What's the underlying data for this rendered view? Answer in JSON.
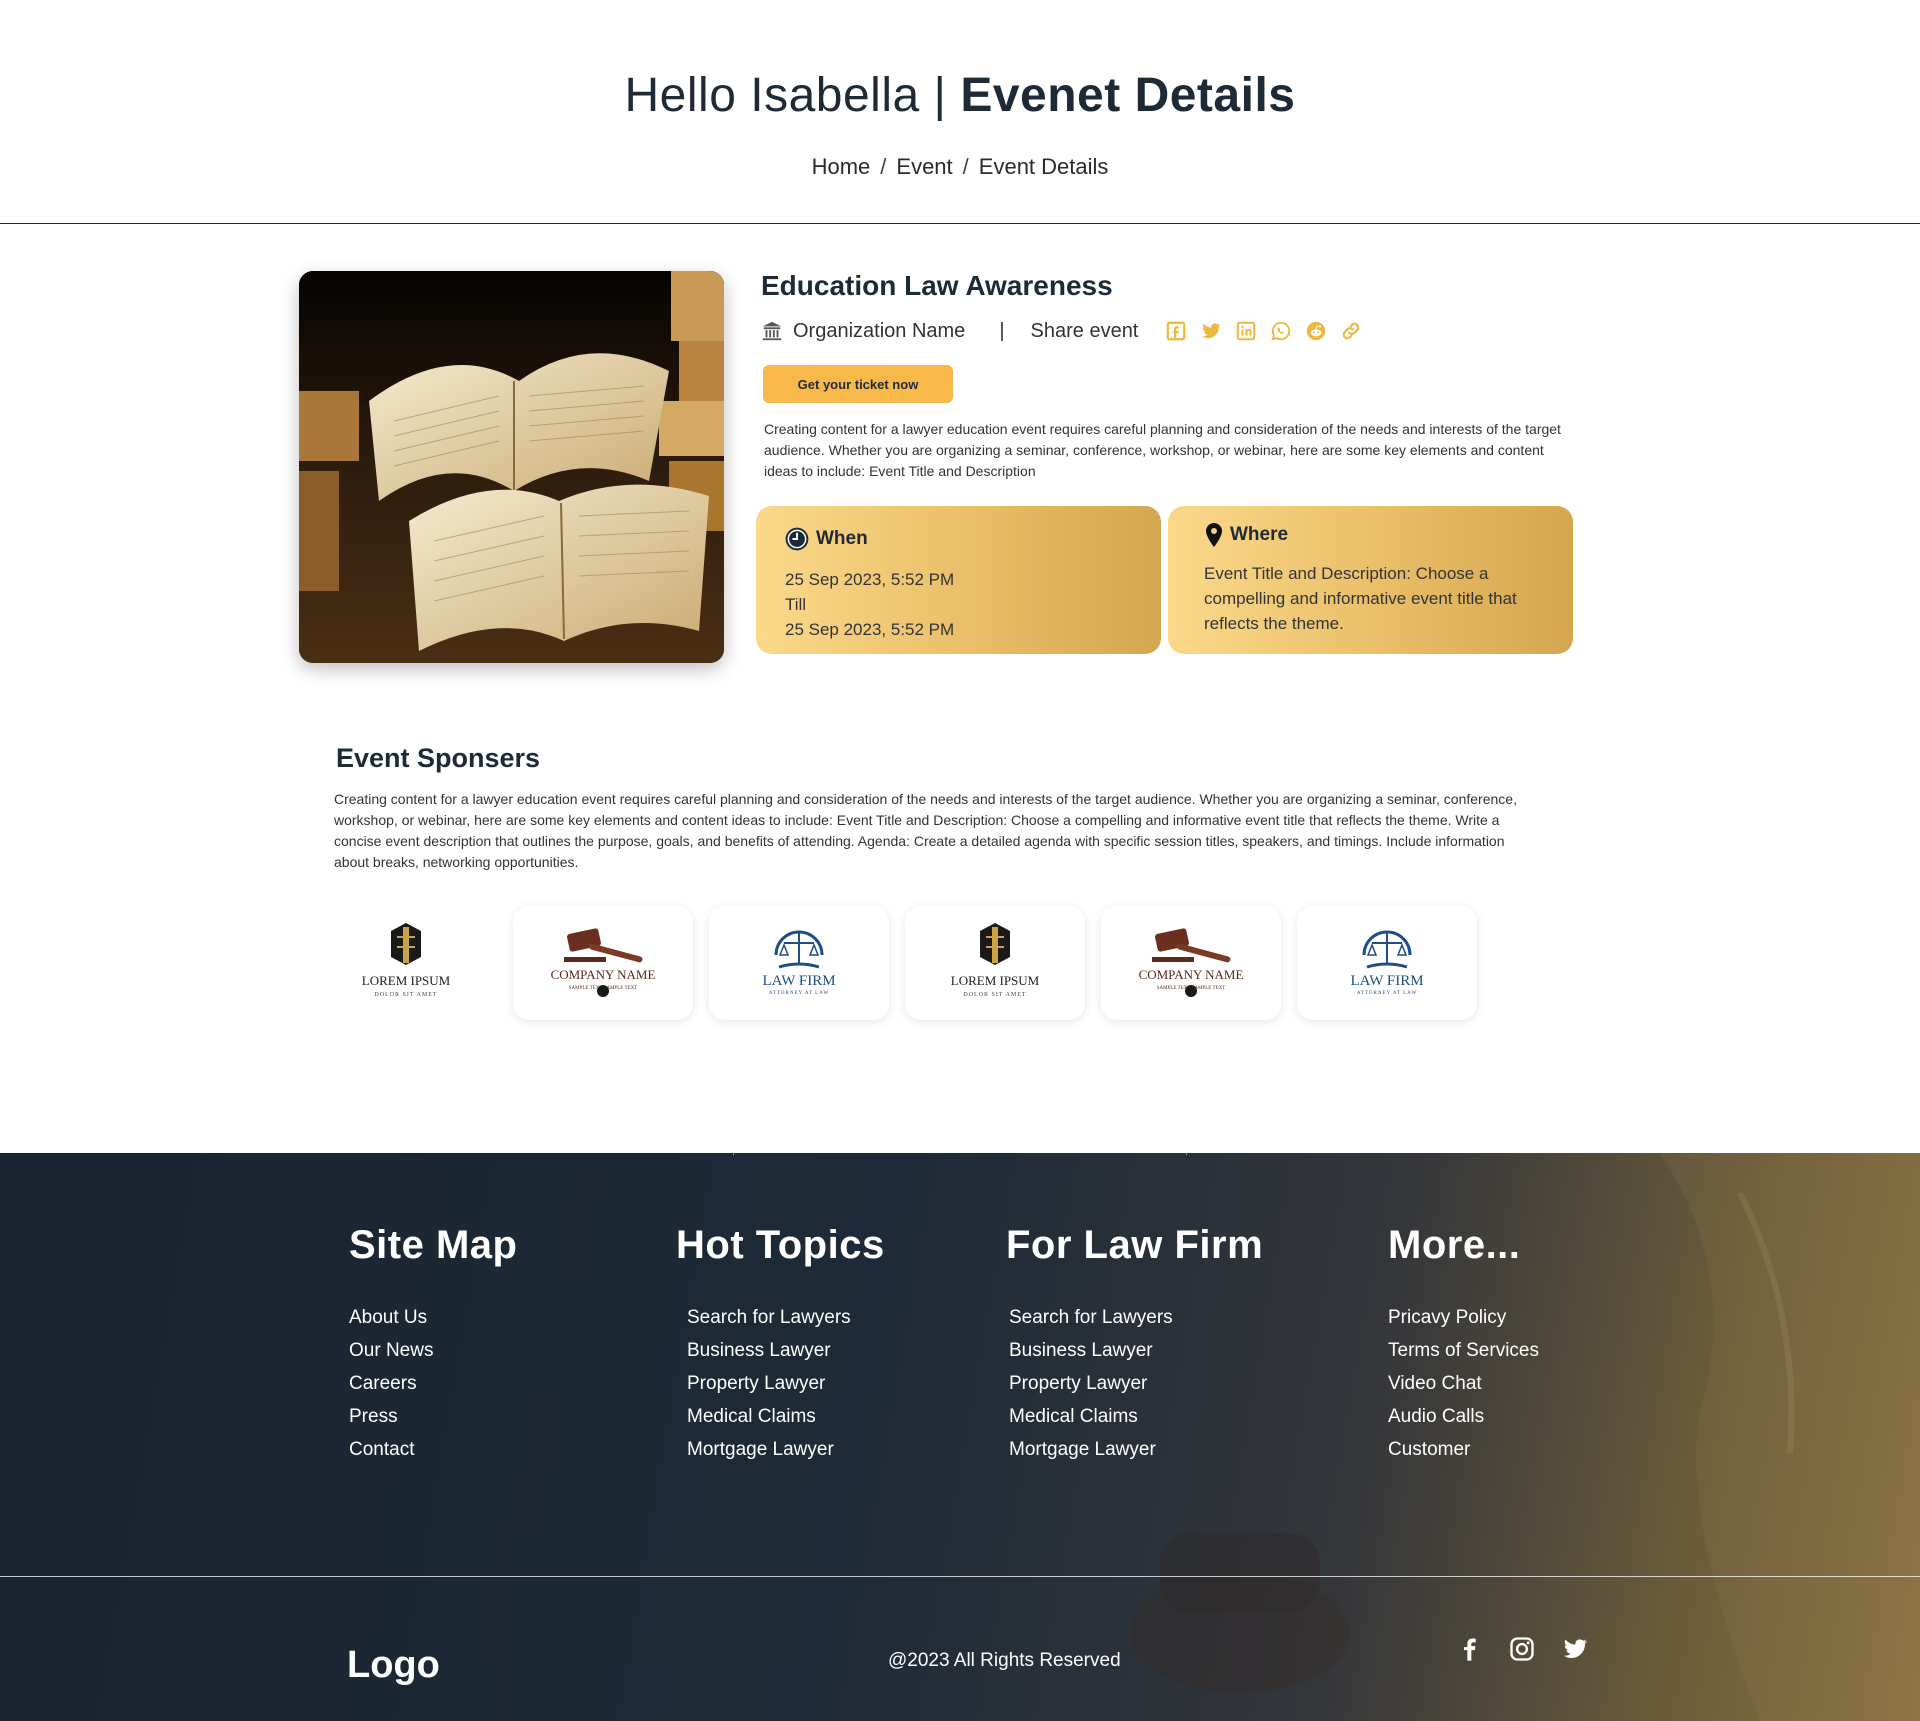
{
  "header": {
    "greeting": "Hello Isabella | ",
    "title": "Evenet Details",
    "breadcrumb": [
      "Home",
      "Event",
      "Event Details"
    ]
  },
  "event": {
    "title": "Education Law Awareness",
    "organization": "Organization Name",
    "share_label": "Share event",
    "share_icons": [
      "facebook-icon",
      "twitter-icon",
      "linkedin-icon",
      "whatsapp-icon",
      "reddit-icon",
      "link-icon"
    ],
    "ticket_button": "Get your ticket now",
    "description": "Creating content for a lawyer education event requires careful planning and consideration of the needs and interests of the target audience. Whether you are organizing a seminar, conference, workshop, or webinar, here are some key elements and content ideas to include: Event Title and Description",
    "when": {
      "label": "When",
      "start": "25 Sep 2023,  5:52 PM",
      "till": "Till",
      "end": "25 Sep 2023,  5:52 PM"
    },
    "where": {
      "label": "Where",
      "text": "Event Title and Description: Choose a compelling and informative event title that reflects the theme."
    }
  },
  "sponsors": {
    "title": "Event Sponsers",
    "description": "Creating content for a lawyer education event requires careful planning and consideration of the needs and interests of the target audience. Whether you are organizing a seminar, conference, workshop, or webinar, here are some key elements and content ideas to include: Event Title and Description: Choose a compelling and informative event title that reflects the theme. Write a concise event description that outlines the purpose, goals, and benefits of attending. Agenda: Create a detailed agenda with specific session titles, speakers, and timings. Include information about breaks, networking opportunities.",
    "logos": [
      {
        "name": "LOREM IPSUM",
        "sub": "DOLOR SIT AMET"
      },
      {
        "name": "COMPANY NAME",
        "sub": "SAMPLE TEXT   SAMPLE TEXT"
      },
      {
        "name": "LAW FIRM",
        "sub": "ATTORNEY AT LAW"
      },
      {
        "name": "LOREM IPSUM",
        "sub": "DOLOR SIT AMET"
      },
      {
        "name": "COMPANY NAME",
        "sub": "SAMPLE TEXT   SAMPLE TEXT"
      },
      {
        "name": "LAW FIRM",
        "sub": "ATTORNEY AT LAW"
      }
    ]
  },
  "footer": {
    "columns": [
      {
        "title": "Site Map",
        "items": [
          "About Us",
          "Our News",
          "Careers",
          "Press",
          "Contact"
        ]
      },
      {
        "title": "Hot Topics",
        "items": [
          "Search for Lawyers",
          "Business Lawyer",
          "Property Lawyer",
          "Medical Claims",
          "Mortgage Lawyer"
        ]
      },
      {
        "title": "For Law Firm",
        "items": [
          "Search for Lawyers",
          "Business Lawyer",
          "Property Lawyer",
          "Medical Claims",
          "Mortgage Lawyer"
        ]
      },
      {
        "title": "More...",
        "items": [
          "Pricavy Policy",
          "Terms of Services",
          "Video Chat",
          "Audio Calls",
          "Customer"
        ]
      }
    ],
    "logo": "Logo",
    "copyright": "@2023 All Rights Reserved",
    "social_icons": [
      "facebook-icon",
      "instagram-icon",
      "twitter-icon"
    ]
  },
  "colors": {
    "accent": "#f8b84a",
    "card_gold": "#e9bd66",
    "text_dark": "#1f2a37",
    "footer_dark": "#1e2a37"
  }
}
